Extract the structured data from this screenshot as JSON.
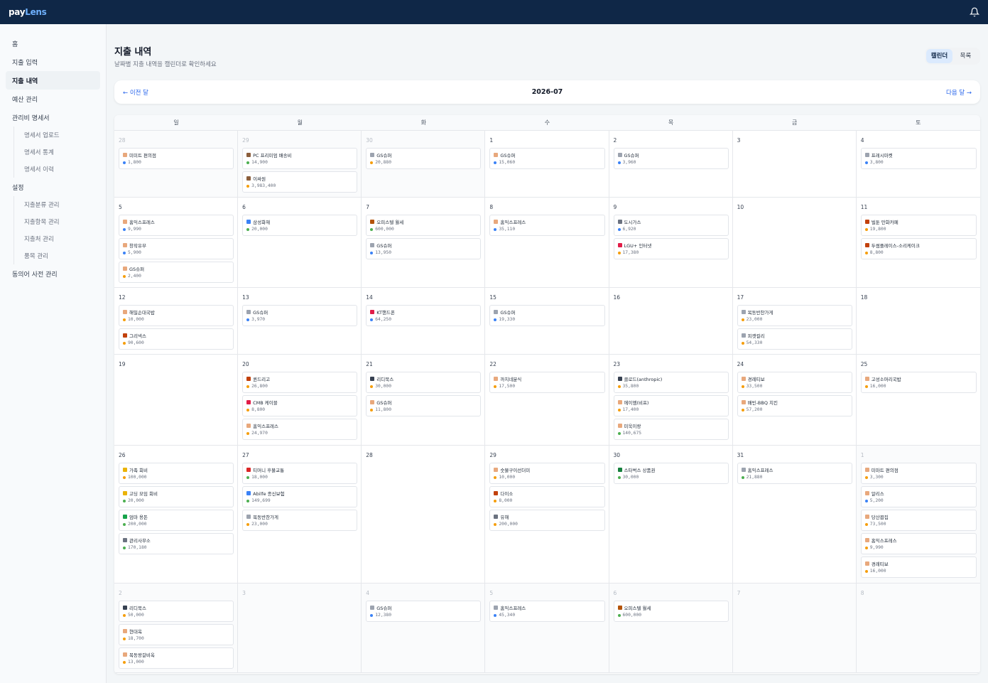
{
  "app": {
    "logo_a": "pay",
    "logo_b": "Lens"
  },
  "colors": {
    "green": "#4caf50",
    "orange": "#f59e0b",
    "blue": "#3b82f6"
  },
  "sidebar": {
    "items": [
      {
        "label": "홈",
        "type": "item"
      },
      {
        "label": "지출 입력",
        "type": "item"
      },
      {
        "label": "지출 내역",
        "type": "item",
        "active": true
      },
      {
        "label": "예산 관리",
        "type": "item"
      },
      {
        "label": "관리비 명세서",
        "type": "item"
      },
      {
        "label": "명세서 업로드",
        "type": "sub"
      },
      {
        "label": "명세서 통계",
        "type": "sub"
      },
      {
        "label": "명세서 이력",
        "type": "sub"
      },
      {
        "label": "설정",
        "type": "item"
      },
      {
        "label": "지출분류 관리",
        "type": "sub"
      },
      {
        "label": "지출항목 관리",
        "type": "sub"
      },
      {
        "label": "지출처 관리",
        "type": "sub"
      },
      {
        "label": "품목 관리",
        "type": "sub"
      },
      {
        "label": "동의어 사전 관리",
        "type": "item"
      }
    ]
  },
  "header": {
    "title": "지출 내역",
    "subtitle": "날짜별 지출 내역을 캘린더로 확인하세요",
    "view_calendar": "캘린더",
    "view_list": "목록"
  },
  "month_nav": {
    "prev": "← 이전 달",
    "month": "2026-07",
    "next": "다음 달 →"
  },
  "weekdays": [
    "일",
    "월",
    "화",
    "수",
    "목",
    "금",
    "토"
  ],
  "weeks": [
    {
      "height": 94,
      "days": [
        {
          "num": "28",
          "other": true,
          "entries": [
            {
              "name": "미미트 편의점",
              "amount": "1,800",
              "icon": "#e8a87c",
              "dot": "blue"
            }
          ]
        },
        {
          "num": "29",
          "other": true,
          "entries": [
            {
              "name": "PC 프리미엄 배송비",
              "amount": "14,900",
              "icon": "#8b5e3c",
              "dot": "green"
            },
            {
              "name": "이싸원",
              "amount": "3,983,400",
              "icon": "#8b5e3c",
              "dot": "orange"
            }
          ]
        },
        {
          "num": "30",
          "other": true,
          "entries": [
            {
              "name": "GS슈퍼",
              "amount": "20,880",
              "icon": "#9ca3af",
              "dot": "orange"
            }
          ]
        },
        {
          "num": "1",
          "entries": [
            {
              "name": "GS슈퍼",
              "amount": "15,060",
              "icon": "#e8a87c",
              "dot": "blue"
            }
          ]
        },
        {
          "num": "2",
          "entries": [
            {
              "name": "GS슈퍼",
              "amount": "3,960",
              "icon": "#9ca3af",
              "dot": "blue"
            }
          ]
        },
        {
          "num": "3",
          "entries": []
        },
        {
          "num": "4",
          "entries": [
            {
              "name": "프레시마켓",
              "amount": "3,800",
              "icon": "#9ca3af",
              "dot": "blue"
            }
          ]
        }
      ]
    },
    {
      "height": 127,
      "days": [
        {
          "num": "5",
          "entries": [
            {
              "name": "홈익스프레스",
              "amount": "9,990",
              "icon": "#e8a87c",
              "dot": "blue"
            },
            {
              "name": "창작유부",
              "amount": "5,900",
              "icon": "#e8a87c",
              "dot": "blue"
            },
            {
              "name": "GS슈퍼",
              "amount": "2,400",
              "icon": "#e8a87c",
              "dot": "orange"
            }
          ]
        },
        {
          "num": "6",
          "entries": [
            {
              "name": "삼성화재",
              "amount": "20,000",
              "icon": "#3b82f6",
              "dot": "green"
            }
          ]
        },
        {
          "num": "7",
          "entries": [
            {
              "name": "오피스텔 월세",
              "amount": "600,000",
              "icon": "#b45309",
              "dot": "green"
            },
            {
              "name": "GS슈퍼",
              "amount": "13,950",
              "icon": "#9ca3af",
              "dot": "blue"
            }
          ]
        },
        {
          "num": "8",
          "entries": [
            {
              "name": "홈익스프레스",
              "amount": "35,110",
              "icon": "#e8a87c",
              "dot": "blue"
            }
          ]
        },
        {
          "num": "9",
          "entries": [
            {
              "name": "도시가스",
              "amount": "6,920",
              "icon": "#6b7280",
              "dot": "blue"
            },
            {
              "name": "LGU+ 인터넷",
              "amount": "17,380",
              "icon": "#e11d48",
              "dot": "orange"
            }
          ]
        },
        {
          "num": "10",
          "entries": []
        },
        {
          "num": "11",
          "entries": [
            {
              "name": "벌툰 만화카페",
              "amount": "19,800",
              "icon": "#c2410c",
              "dot": "orange"
            },
            {
              "name": "두썸플레이스-소리케이크",
              "amount": "8,800",
              "icon": "#c2410c",
              "dot": "orange"
            }
          ]
        }
      ]
    },
    {
      "height": 94,
      "days": [
        {
          "num": "12",
          "entries": [
            {
              "name": "해밀손대국밥",
              "amount": "10,000",
              "icon": "#e8a87c",
              "dot": "orange"
            },
            {
              "name": "그리넥스",
              "amount": "90,600",
              "icon": "#c2410c",
              "dot": "orange"
            }
          ]
        },
        {
          "num": "13",
          "entries": [
            {
              "name": "GS슈퍼",
              "amount": "3,970",
              "icon": "#9ca3af",
              "dot": "blue"
            }
          ]
        },
        {
          "num": "14",
          "entries": [
            {
              "name": "KT핸드폰",
              "amount": "64,250",
              "icon": "#e11d48",
              "dot": "blue"
            }
          ]
        },
        {
          "num": "15",
          "entries": [
            {
              "name": "GS슈퍼",
              "amount": "19,330",
              "icon": "#9ca3af",
              "dot": "blue"
            }
          ]
        },
        {
          "num": "16",
          "entries": []
        },
        {
          "num": "17",
          "entries": [
            {
              "name": "목동반찬가게",
              "amount": "23,000",
              "icon": "#9ca3af",
              "dot": "orange"
            },
            {
              "name": "피캣컬리",
              "amount": "54,330",
              "icon": "#9ca3af",
              "dot": "orange"
            }
          ]
        },
        {
          "num": "18",
          "entries": []
        }
      ]
    },
    {
      "height": 128,
      "days": [
        {
          "num": "19",
          "entries": []
        },
        {
          "num": "20",
          "entries": [
            {
              "name": "퀸드리고",
              "amount": "26,800",
              "icon": "#c2410c",
              "dot": "orange"
            },
            {
              "name": "CMB 케이블",
              "amount": "8,800",
              "icon": "#e11d48",
              "dot": "orange"
            },
            {
              "name": "홈익스프레스",
              "amount": "24,970",
              "icon": "#e8a87c",
              "dot": "orange"
            }
          ]
        },
        {
          "num": "21",
          "entries": [
            {
              "name": "리디북스",
              "amount": "30,000",
              "icon": "#374151",
              "dot": "orange"
            },
            {
              "name": "GS슈퍼",
              "amount": "11,800",
              "icon": "#e8a87c",
              "dot": "orange"
            }
          ]
        },
        {
          "num": "22",
          "entries": [
            {
              "name": "까치네분식",
              "amount": "17,500",
              "icon": "#e8a87c",
              "dot": "orange"
            }
          ]
        },
        {
          "num": "23",
          "entries": [
            {
              "name": "클로드(anthropic)",
              "amount": "35,800",
              "icon": "#374151",
              "dot": "orange"
            },
            {
              "name": "에이엠(비프)",
              "amount": "17,400",
              "icon": "#e8a87c",
              "dot": "orange"
            },
            {
              "name": "미욱이랑",
              "amount": "140,675",
              "icon": "#e8a87c",
              "dot": "green"
            }
          ]
        },
        {
          "num": "24",
          "entries": [
            {
              "name": "경례티보",
              "amount": "33,500",
              "icon": "#e8a87c",
              "dot": "orange"
            },
            {
              "name": "배빈-BBQ 치킨",
              "amount": "57,200",
              "icon": "#e8a87c",
              "dot": "orange"
            }
          ]
        },
        {
          "num": "25",
          "entries": [
            {
              "name": "고성소머리국밥",
              "amount": "16,000",
              "icon": "#e8a87c",
              "dot": "orange"
            }
          ]
        }
      ]
    },
    {
      "height": 194,
      "days": [
        {
          "num": "26",
          "entries": [
            {
              "name": "가족 회비",
              "amount": "100,000",
              "icon": "#eab308",
              "dot": "orange"
            },
            {
              "name": "고딩 모임 회비",
              "amount": "20,000",
              "icon": "#eab308",
              "dot": "green"
            },
            {
              "name": "엄마 용돈",
              "amount": "200,000",
              "icon": "#16a34a",
              "dot": "green"
            },
            {
              "name": "관리사무소",
              "amount": "170,180",
              "icon": "#6b7280",
              "dot": "green"
            }
          ]
        },
        {
          "num": "27",
          "entries": [
            {
              "name": "티머니 후불교통",
              "amount": "18,000",
              "icon": "#dc2626",
              "dot": "green"
            },
            {
              "name": "Abilfe 종신보험",
              "amount": "149,699",
              "icon": "#3b82f6",
              "dot": "green"
            },
            {
              "name": "목동반찬가게",
              "amount": "23,000",
              "icon": "#9ca3af",
              "dot": "orange"
            }
          ]
        },
        {
          "num": "28",
          "entries": []
        },
        {
          "num": "29",
          "entries": [
            {
              "name": "숫불구이선더미",
              "amount": "10,000",
              "icon": "#e8a87c",
              "dot": "orange"
            },
            {
              "name": "다이소",
              "amount": "8,000",
              "icon": "#c2410c",
              "dot": "orange"
            },
            {
              "name": "유해",
              "amount": "200,000",
              "icon": "#6b7280",
              "dot": "orange"
            }
          ]
        },
        {
          "num": "30",
          "entries": [
            {
              "name": "스타벅스 상품권",
              "amount": "30,000",
              "icon": "#15803d",
              "dot": "green"
            }
          ]
        },
        {
          "num": "31",
          "entries": [
            {
              "name": "홈익스프레스",
              "amount": "21,880",
              "icon": "#9ca3af",
              "dot": "green"
            }
          ]
        },
        {
          "num": "1",
          "other": true,
          "entries": [
            {
              "name": "미마트 편의점",
              "amount": "3,300",
              "icon": "#e8a87c",
              "dot": "orange"
            },
            {
              "name": "알리스",
              "amount": "5,200",
              "icon": "#e8a87c",
              "dot": "blue"
            },
            {
              "name": "당산꼽집",
              "amount": "73,500",
              "icon": "#e8a87c",
              "dot": "orange"
            },
            {
              "name": "홈익스프레스",
              "amount": "9,990",
              "icon": "#e8a87c",
              "dot": "orange"
            },
            {
              "name": "경례티보",
              "amount": "16,000",
              "icon": "#e8a87c",
              "dot": "orange"
            }
          ]
        }
      ]
    },
    {
      "height": 126,
      "days": [
        {
          "num": "2",
          "other": true,
          "entries": [
            {
              "name": "리디북스",
              "amount": "50,000",
              "icon": "#374151",
              "dot": "orange"
            },
            {
              "name": "현대옥",
              "amount": "18,700",
              "icon": "#e8a87c",
              "dot": "orange"
            },
            {
              "name": "목동왕갈비옥",
              "amount": "13,000",
              "icon": "#e8a87c",
              "dot": "orange"
            }
          ]
        },
        {
          "num": "3",
          "other": true,
          "entries": []
        },
        {
          "num": "4",
          "other": true,
          "entries": [
            {
              "name": "GS슈퍼",
              "amount": "12,380",
              "icon": "#9ca3af",
              "dot": "blue"
            }
          ]
        },
        {
          "num": "5",
          "other": true,
          "entries": [
            {
              "name": "홈익스프레스",
              "amount": "45,340",
              "icon": "#9ca3af",
              "dot": "blue"
            }
          ]
        },
        {
          "num": "6",
          "other": true,
          "entries": [
            {
              "name": "오피스텔 월세",
              "amount": "600,000",
              "icon": "#b45309",
              "dot": "green"
            }
          ]
        },
        {
          "num": "7",
          "other": true,
          "entries": []
        },
        {
          "num": "8",
          "other": true,
          "entries": []
        }
      ]
    }
  ]
}
